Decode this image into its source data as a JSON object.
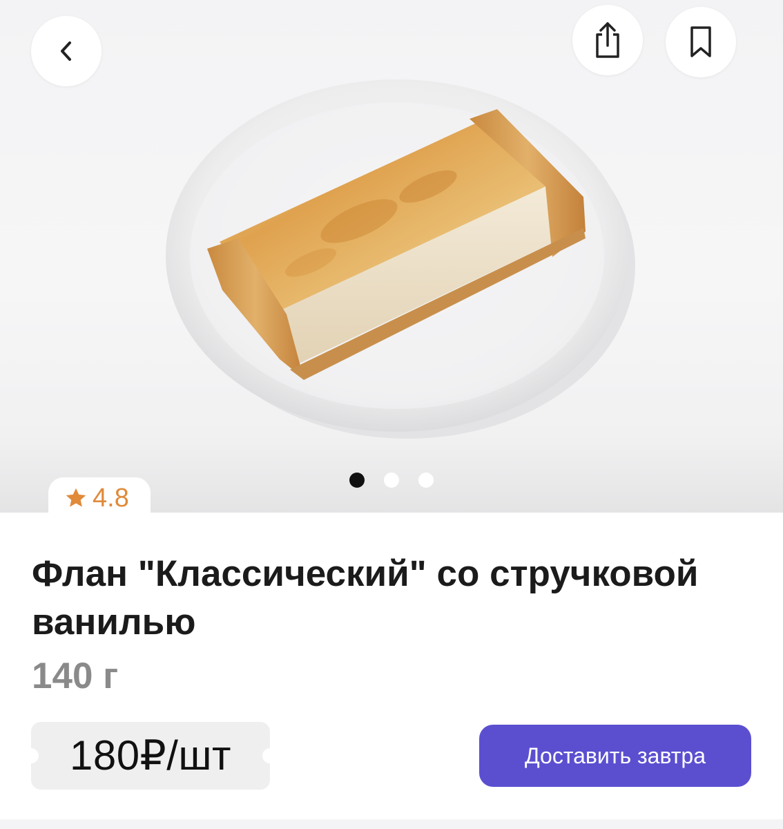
{
  "gallery": {
    "image_count": 3,
    "active_index": 0
  },
  "header": {
    "back_icon": "chevron-left-icon",
    "share_icon": "share-icon",
    "bookmark_icon": "bookmark-icon"
  },
  "rating": {
    "icon": "star-icon",
    "value": "4.8",
    "color": "#e08a3a"
  },
  "product": {
    "title": "Флан \"Классический\" со стручковой ванилью",
    "weight": "140 г",
    "price": "180₽/шт"
  },
  "actions": {
    "deliver_label": "Доставить завтра",
    "accent": "#5b4fd0"
  }
}
